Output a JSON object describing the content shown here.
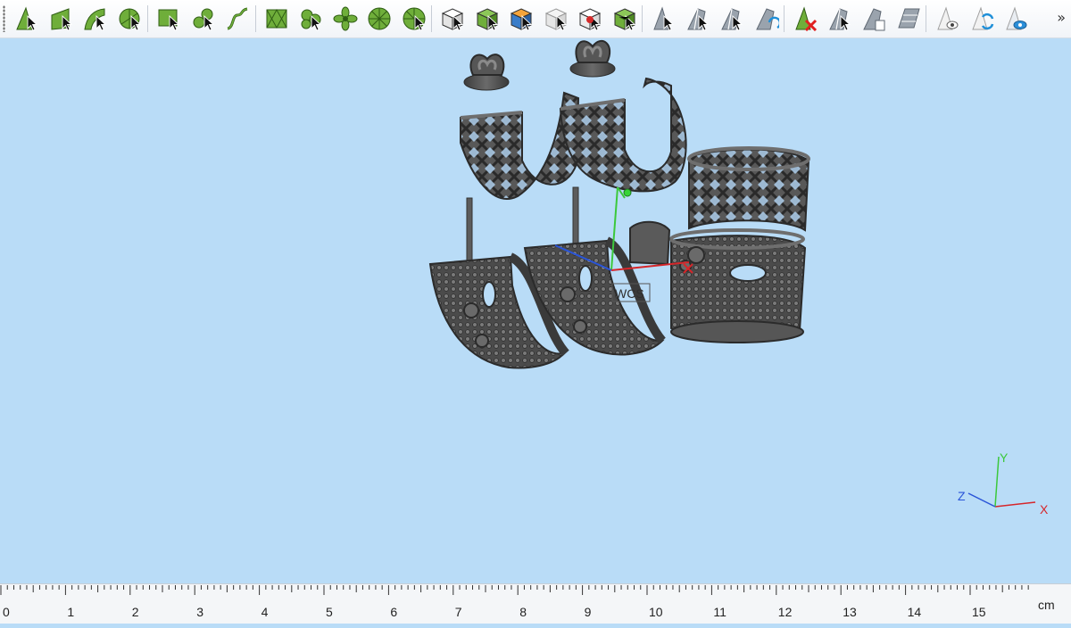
{
  "toolbar": {
    "overflow_label": "»",
    "groups": [
      [
        {
          "name": "select-surface-icon",
          "style": "arrow-tri"
        },
        {
          "name": "select-face-icon",
          "style": "arrow-quad"
        },
        {
          "name": "select-curve-icon",
          "style": "arrow-curve"
        },
        {
          "name": "select-section-icon",
          "style": "arrow-circle"
        }
      ],
      [
        {
          "name": "select-rectangle-icon",
          "style": "box-arrow"
        },
        {
          "name": "select-blobs-icon",
          "style": "blobs"
        },
        {
          "name": "select-sketch-icon",
          "style": "sketch"
        }
      ],
      [
        {
          "name": "triangles-wireframe-icon",
          "style": "wire"
        },
        {
          "name": "select-clusters-icon",
          "style": "clusters"
        },
        {
          "name": "flower-pattern-icon",
          "style": "flower"
        },
        {
          "name": "wheel-segments-icon",
          "style": "wheel"
        },
        {
          "name": "wheel-half-icon",
          "style": "wheel-half"
        }
      ],
      [
        {
          "name": "cube-white-icon",
          "style": "cube-white"
        },
        {
          "name": "cube-green-icon",
          "style": "cube-green"
        },
        {
          "name": "cube-orange-icon",
          "style": "cube-orange"
        },
        {
          "name": "cube-outline-icon",
          "style": "cube-outline"
        },
        {
          "name": "cube-red-icon",
          "style": "cube-red"
        },
        {
          "name": "cube-grid-icon",
          "style": "cube-grid"
        }
      ],
      [
        {
          "name": "arrow-gray-icon",
          "style": "gray-arrow"
        },
        {
          "name": "shard-gray-icon",
          "style": "gray-shard"
        },
        {
          "name": "shard-arrow-icon",
          "style": "gray-shard"
        },
        {
          "name": "shard-swap-icon",
          "style": "gray-swap"
        }
      ],
      [
        {
          "name": "delete-selection-icon",
          "style": "delete"
        },
        {
          "name": "shard-copy-icon",
          "style": "gray-shard"
        },
        {
          "name": "shard-doc-icon",
          "style": "gray-doc"
        },
        {
          "name": "shard-panel-icon",
          "style": "gray-panel"
        }
      ],
      [
        {
          "name": "eye-white-icon",
          "style": "eye-white"
        },
        {
          "name": "swap-blue-icon",
          "style": "swap-blue"
        },
        {
          "name": "eye-blue-icon",
          "style": "eye-blue"
        }
      ]
    ]
  },
  "viewport": {
    "wcs_label": "WCS",
    "triad": {
      "x_label": "X",
      "y_label": "Y",
      "z_label": "Z"
    },
    "colors": {
      "background": "#b9dcf7",
      "model": "#4a4a4a",
      "axis_x": "#d6262a",
      "axis_y": "#3cc83c",
      "axis_z": "#2a55d8"
    }
  },
  "ruler": {
    "labels": [
      "0",
      "1",
      "2",
      "3",
      "4",
      "5",
      "6",
      "7",
      "8",
      "9",
      "10",
      "11",
      "12",
      "13",
      "14",
      "15"
    ],
    "unit": "cm"
  }
}
